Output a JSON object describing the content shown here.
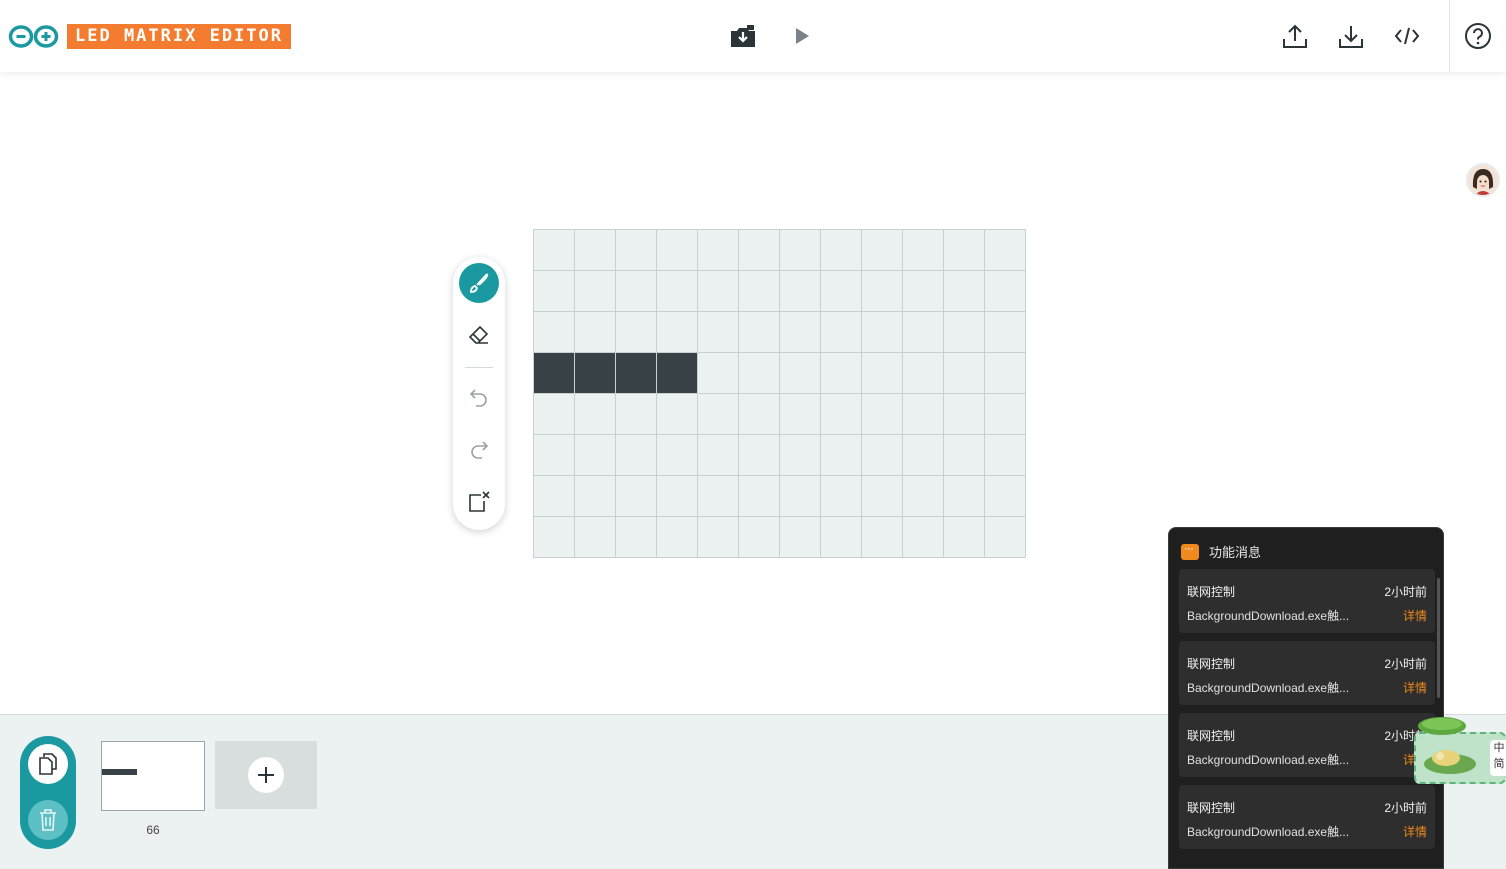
{
  "app": {
    "title": "LED MATRIX EDITOR"
  },
  "colors": {
    "accent": "#1a9aa0",
    "brand_orange": "#f47c30",
    "pixel_on": "#374146",
    "pixel_off": "#ecf1f1",
    "notification_link": "#f08a1c"
  },
  "header": {
    "buttons": [
      {
        "name": "import-sketch-icon"
      },
      {
        "name": "play-icon"
      },
      {
        "name": "upload-icon"
      },
      {
        "name": "download-icon"
      },
      {
        "name": "code-icon"
      },
      {
        "name": "help-icon"
      }
    ]
  },
  "toolbar": {
    "tools": [
      "brush-icon",
      "eraser-icon",
      "undo-icon",
      "redo-icon",
      "clear-frame-icon"
    ],
    "active": "brush-icon"
  },
  "matrix": {
    "columns": 12,
    "rows": 8,
    "on_cells": [
      [
        3,
        0
      ],
      [
        3,
        1
      ],
      [
        3,
        2
      ],
      [
        3,
        3
      ]
    ]
  },
  "frames": {
    "items": [
      {
        "label": "66"
      }
    ],
    "duplicate_icon": "duplicate-icon",
    "delete_icon": "trash-icon",
    "add_icon": "plus-icon"
  },
  "notifications": {
    "header": "功能消息",
    "items": [
      {
        "title": "联网控制",
        "time": "2小时前",
        "body": "BackgroundDownload.exe触...",
        "link": "详情"
      },
      {
        "title": "联网控制",
        "time": "2小时前",
        "body": "BackgroundDownload.exe触...",
        "link": "详情"
      },
      {
        "title": "联网控制",
        "time": "2小时前",
        "body": "BackgroundDownload.exe触...",
        "link": "详情"
      },
      {
        "title": "联网控制",
        "time": "2小时前",
        "body": "BackgroundDownload.exe触...",
        "link": "详情"
      }
    ]
  },
  "pet_widget": {
    "text": "中\n简"
  }
}
